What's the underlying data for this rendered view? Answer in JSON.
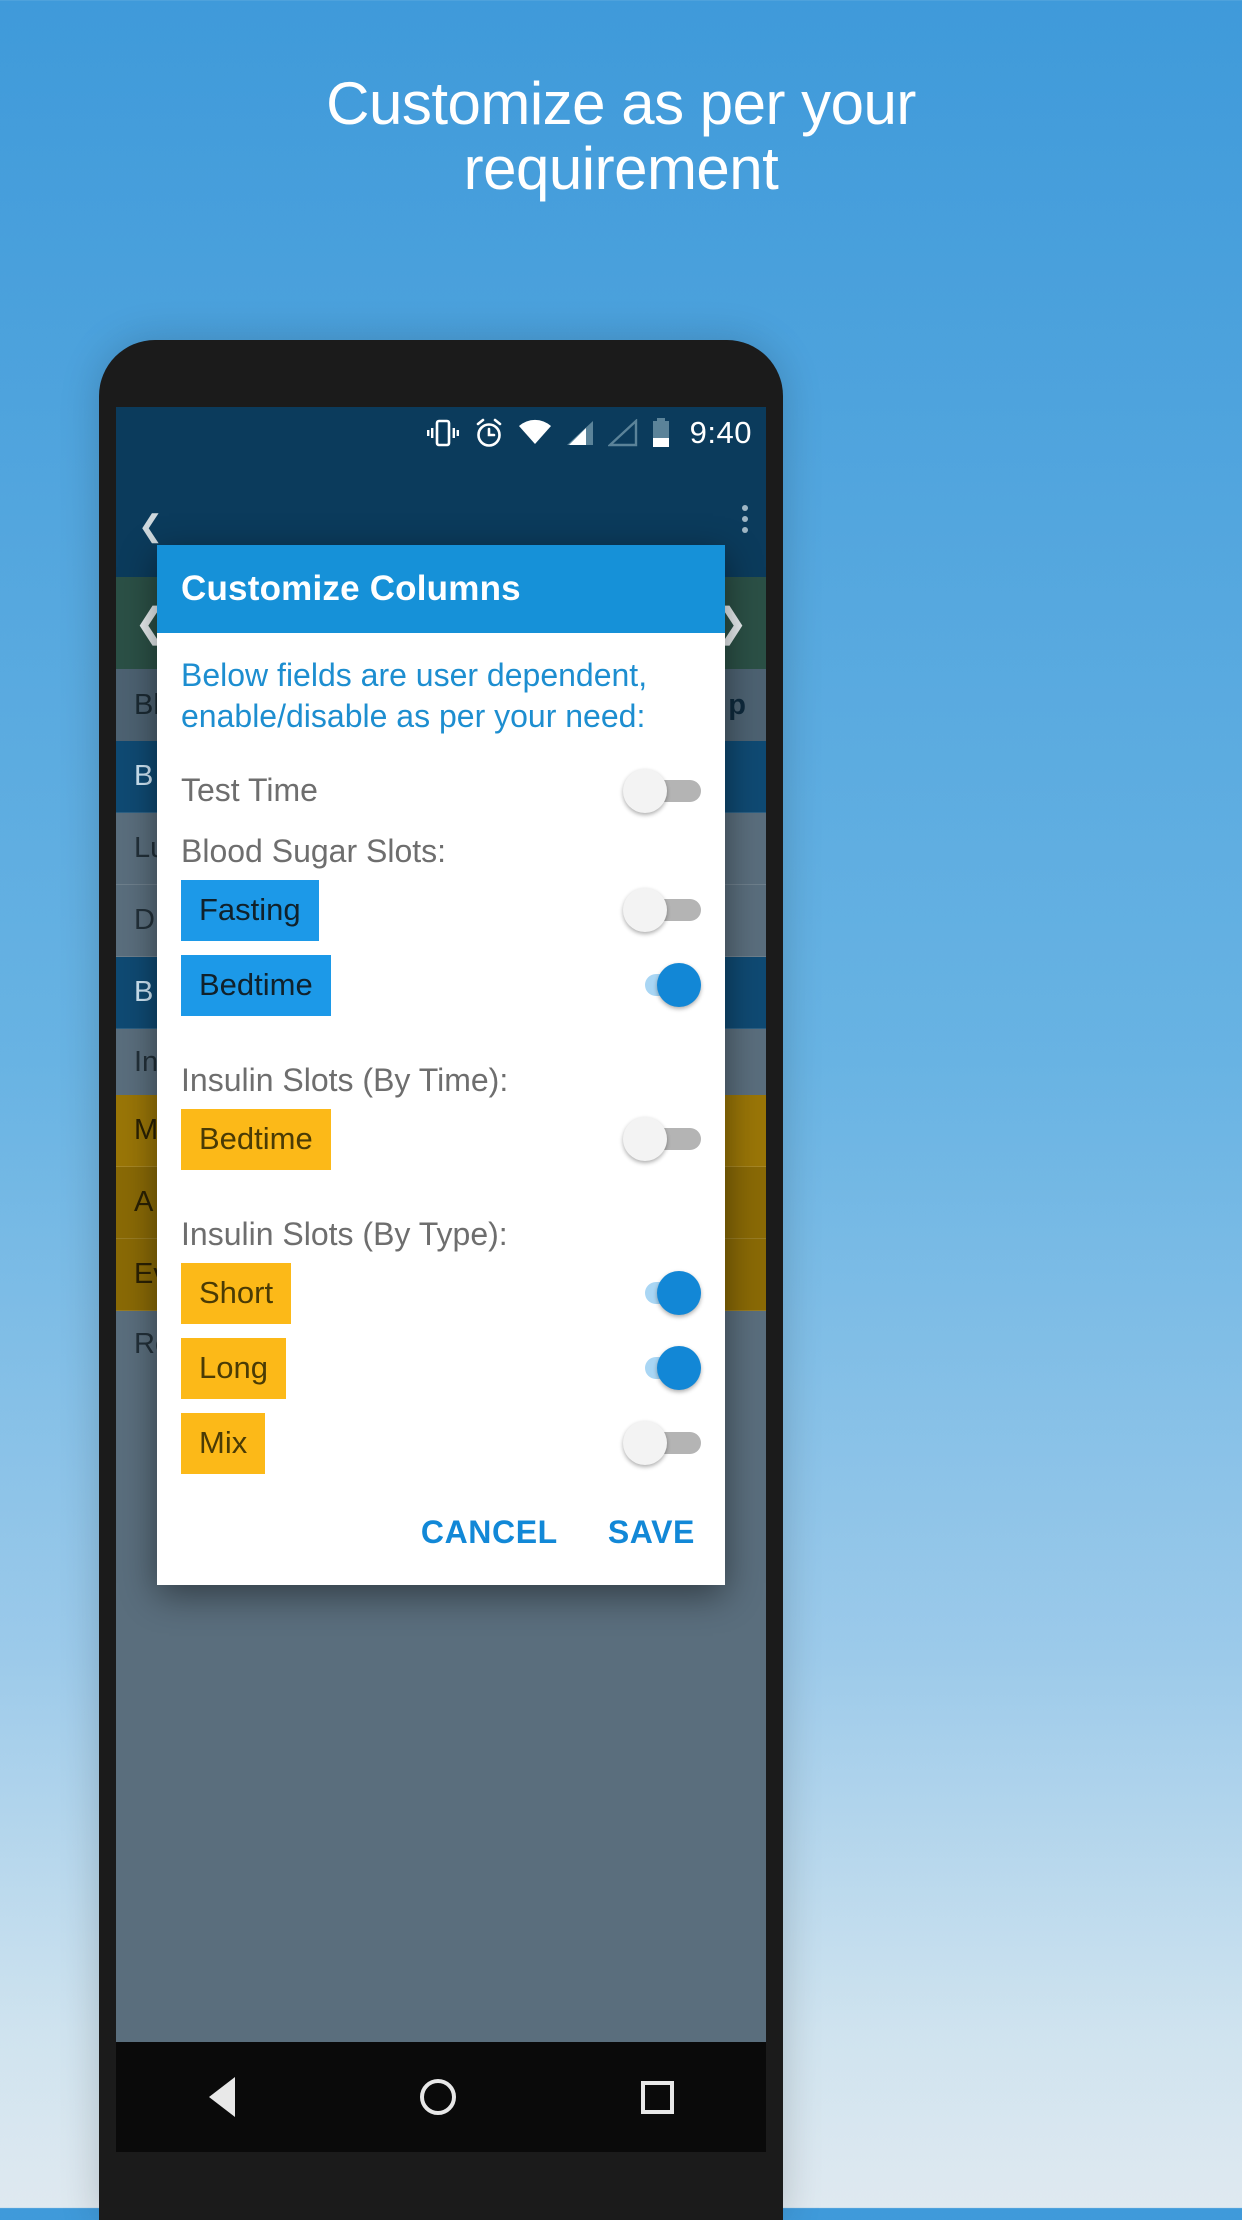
{
  "promo": {
    "headline_line1": "Customize as per your",
    "headline_line2": "requirement"
  },
  "statusbar": {
    "time": "9:40",
    "icons": [
      "vibrate-icon",
      "alarm-icon",
      "wifi-icon",
      "signal-icon",
      "signal-empty-icon",
      "battery-icon"
    ]
  },
  "app_background": {
    "nav_prev": "❮",
    "nav_next": "❯",
    "table_header_left": "Bl",
    "table_header_right": "p",
    "rows": [
      "B",
      "Lu",
      "D",
      "B"
    ],
    "section_label": "Ins",
    "type_rows": [
      "M",
      "A",
      "Ev"
    ],
    "footer_label": "Re"
  },
  "dialog": {
    "title": "Customize Columns",
    "description": "Below fields are user dependent, enable/disable as per your need:",
    "test_time": {
      "label": "Test Time",
      "enabled": false
    },
    "blood_sugar": {
      "section_label": "Blood Sugar Slots:",
      "slots": [
        {
          "label": "Fasting",
          "enabled": false
        },
        {
          "label": "Bedtime",
          "enabled": true
        }
      ]
    },
    "insulin_by_time": {
      "section_label": "Insulin Slots (By Time):",
      "slots": [
        {
          "label": "Bedtime",
          "enabled": false
        }
      ]
    },
    "insulin_by_type": {
      "section_label": "Insulin Slots (By Type):",
      "slots": [
        {
          "label": "Short",
          "enabled": true
        },
        {
          "label": "Long",
          "enabled": true
        },
        {
          "label": "Mix",
          "enabled": false
        }
      ]
    },
    "cancel_label": "CANCEL",
    "save_label": "SAVE"
  },
  "colors": {
    "accent_blue": "#1691d8",
    "chip_blue": "#1c99e8",
    "chip_amber": "#fcb918",
    "switch_on": "#1287d6",
    "switch_off": "#b4b4b4"
  },
  "navbar": {
    "back": "back-icon",
    "home": "home-icon",
    "recents": "recents-icon"
  }
}
